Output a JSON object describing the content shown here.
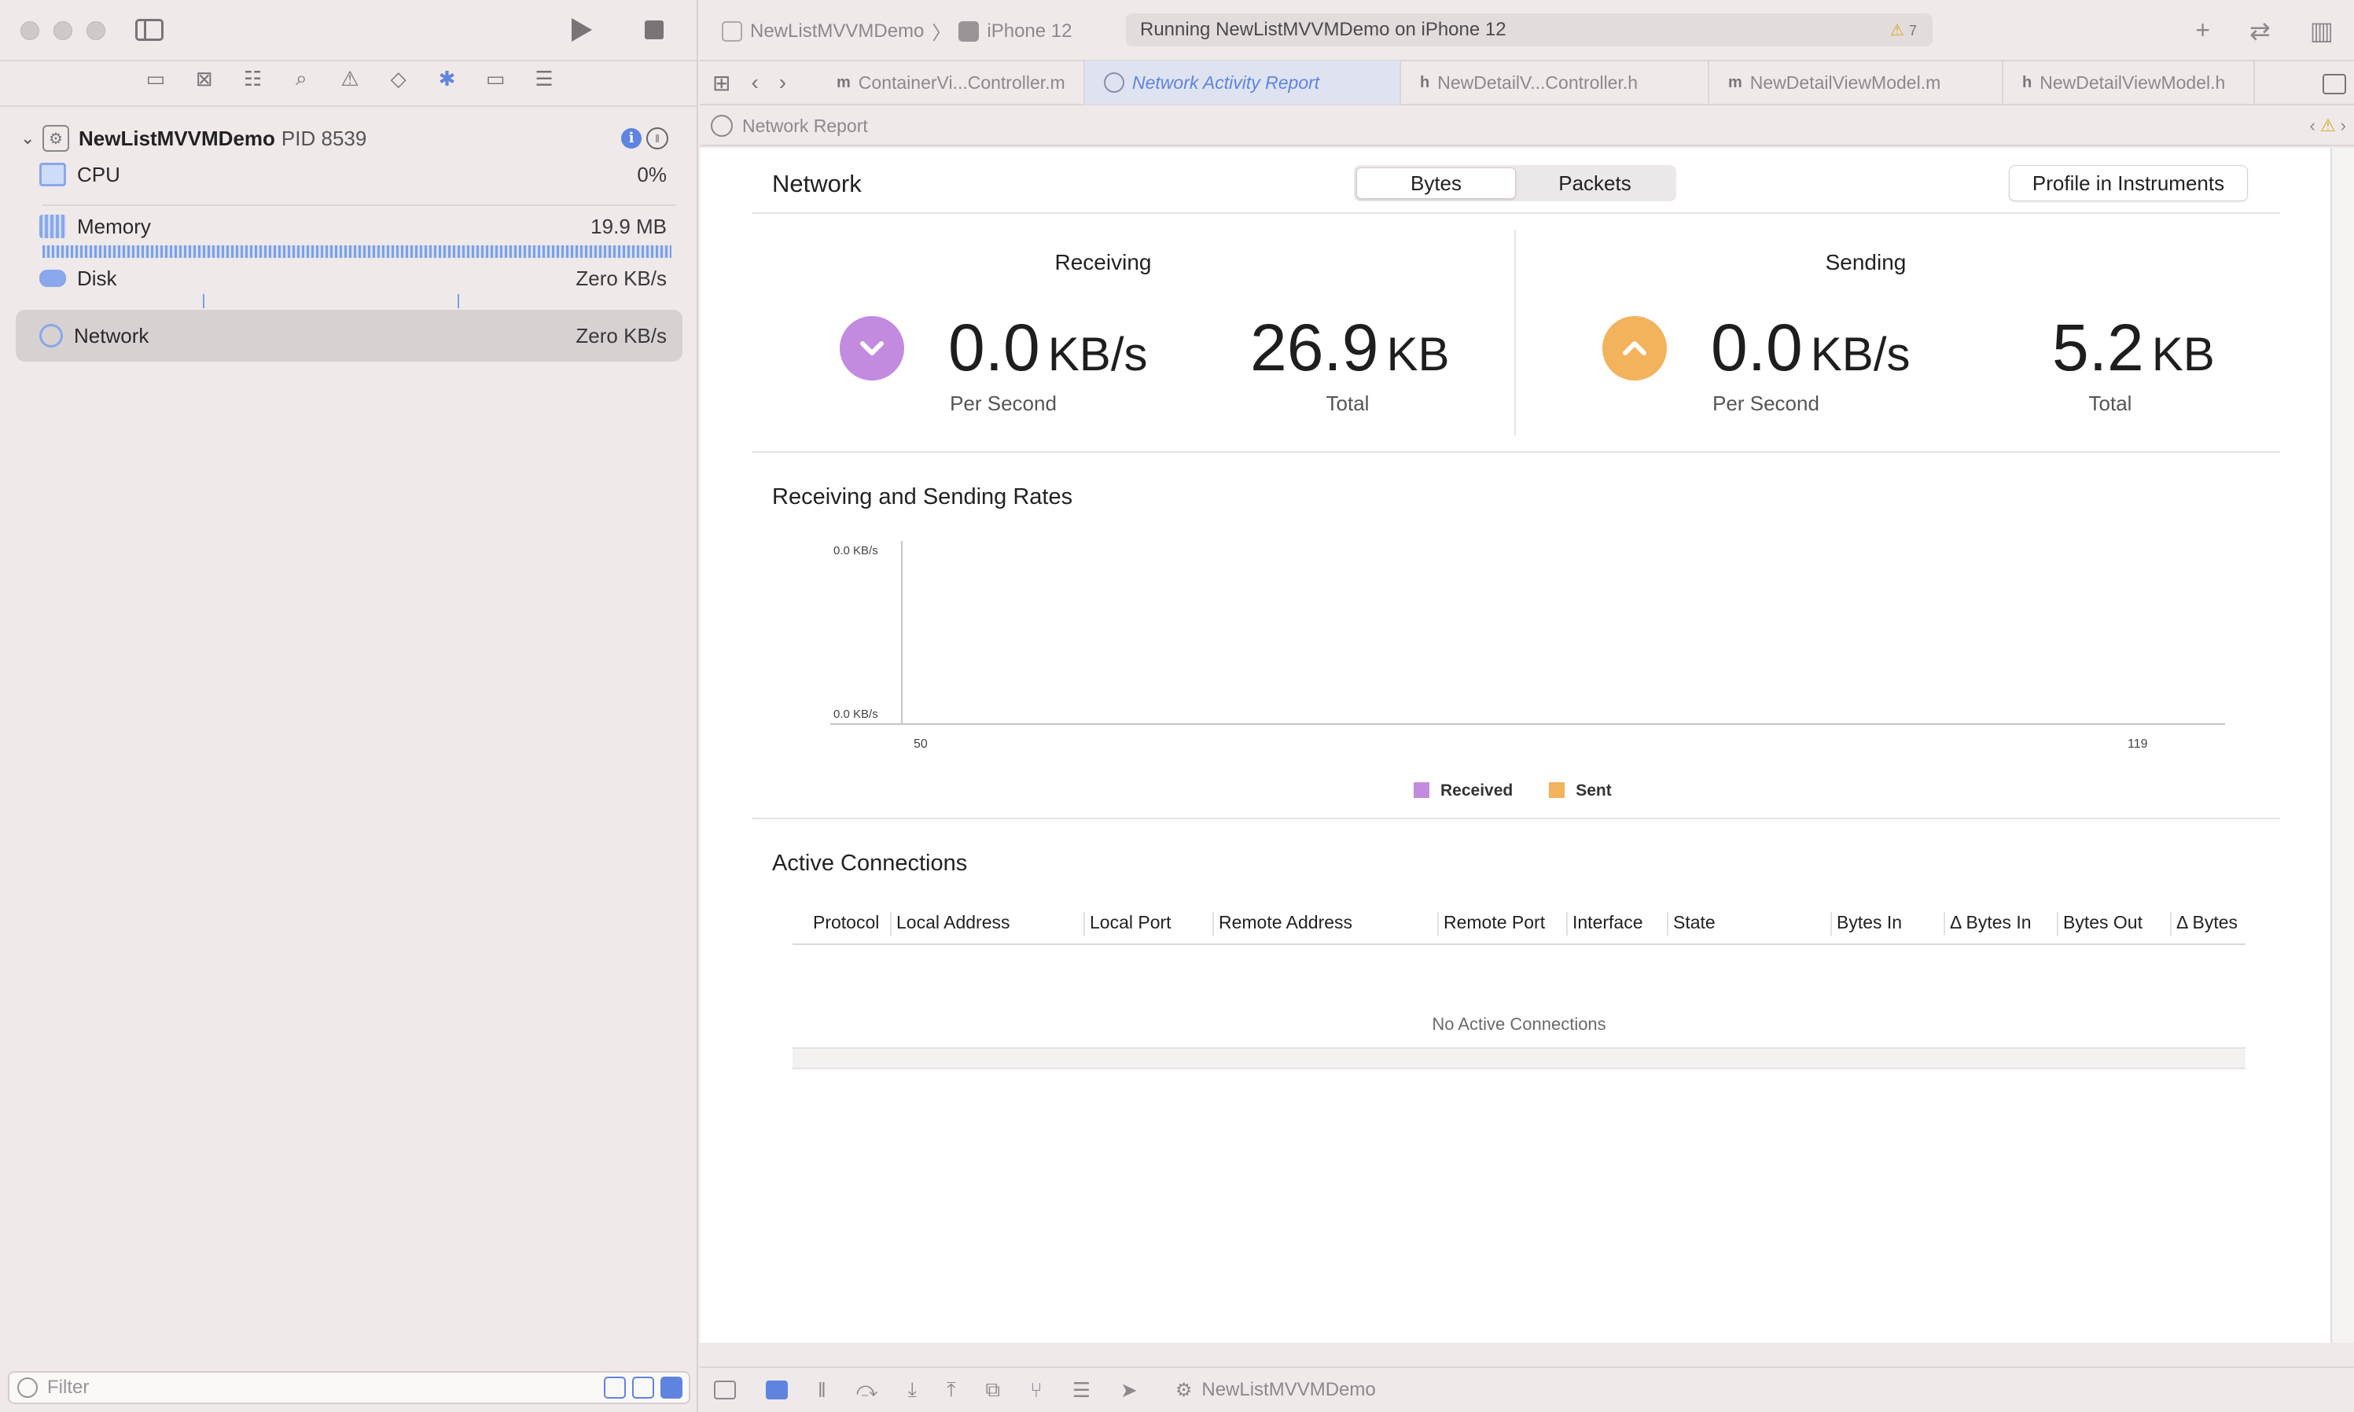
{
  "window": {
    "scheme": "NewListMVVMDemo",
    "destination": "iPhone 12",
    "status": "Running NewListMVVMDemo on iPhone 12",
    "warning_count": "7"
  },
  "navigator": {
    "process": {
      "name": "NewListMVVMDemo",
      "pid": "PID 8539"
    },
    "gauges": [
      {
        "label": "CPU",
        "value": "0%"
      },
      {
        "label": "Memory",
        "value": "19.9 MB"
      },
      {
        "label": "Disk",
        "value": "Zero KB/s"
      },
      {
        "label": "Network",
        "value": "Zero KB/s"
      }
    ],
    "filter_placeholder": "Filter"
  },
  "tabs": [
    {
      "prefix": "m",
      "label": "ContainerVi...Controller.m"
    },
    {
      "prefix": "",
      "label": "Network Activity Report"
    },
    {
      "prefix": "h",
      "label": "NewDetailV...Controller.h"
    },
    {
      "prefix": "m",
      "label": "NewDetailViewModel.m"
    },
    {
      "prefix": "h",
      "label": "NewDetailViewModel.h"
    }
  ],
  "jumpbar": {
    "label": "Network Report"
  },
  "report": {
    "title": "Network",
    "segments": [
      "Bytes",
      "Packets"
    ],
    "selected_segment": "Bytes",
    "profile_button": "Profile in Instruments",
    "receiving": {
      "title": "Receiving",
      "rate_value": "0.0",
      "rate_unit": "KB/s",
      "rate_label": "Per Second",
      "total_value": "26.9",
      "total_unit": "KB",
      "total_label": "Total",
      "color": "#c28be0"
    },
    "sending": {
      "title": "Sending",
      "rate_value": "0.0",
      "rate_unit": "KB/s",
      "rate_label": "Per Second",
      "total_value": "5.2",
      "total_unit": "KB",
      "total_label": "Total",
      "color": "#f3b25c"
    },
    "rates_title": "Receiving and Sending Rates",
    "legend": [
      {
        "label": "Received",
        "color": "#c28be0"
      },
      {
        "label": "Sent",
        "color": "#f3b25c"
      }
    ],
    "connections_title": "Active Connections",
    "columns": [
      "Protocol",
      "Local Address",
      "Local Port",
      "Remote Address",
      "Remote Port",
      "Interface",
      "State",
      "Bytes In",
      "Δ Bytes In",
      "Bytes Out",
      "Δ Bytes"
    ],
    "empty_message": "No Active Connections"
  },
  "chart_data": {
    "type": "line",
    "x": [
      50,
      119
    ],
    "xlim": [
      50,
      119
    ],
    "ylim": [
      0.0,
      0.0
    ],
    "y_tick_labels": [
      "0.0 KB/s",
      "0.0 KB/s"
    ],
    "x_tick_labels": [
      "50",
      "119"
    ],
    "series": [
      {
        "name": "Received",
        "values": []
      },
      {
        "name": "Sent",
        "values": []
      }
    ]
  },
  "debug_bar": {
    "process": "NewListMVVMDemo"
  }
}
